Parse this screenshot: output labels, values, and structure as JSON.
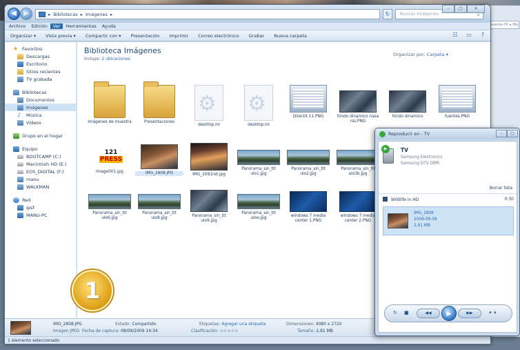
{
  "address": {
    "crumbs": [
      "Bibliotecas",
      "Imágenes"
    ],
    "search_placeholder": "Buscar Imágenes"
  },
  "menu": [
    "Archivo",
    "Edición",
    "Ver",
    "Herramientas",
    "Ayuda"
  ],
  "toolbar": [
    "Organizar ▾",
    "Vista previa ▾",
    "Compartir con ▾",
    "Presentación",
    "Imprimir",
    "Correo electrónico",
    "Grabar",
    "Nueva carpeta"
  ],
  "sidebar": {
    "favoritos": "Favoritos",
    "fav_items": [
      "Descargas",
      "Escritorio",
      "Sitios recientes",
      "TV grabada"
    ],
    "bibliotecas": "Bibliotecas",
    "lib_items": [
      "Documentos",
      "Imágenes",
      "Música",
      "Vídeos"
    ],
    "grupo": "Grupo en el hogar",
    "equipo": "Equipo",
    "equipo_items": [
      "BOOTCAMP (C:)",
      "Macintosh HD (E:)",
      "EOS_DIGITAL (F:)",
      "manu",
      "WALKMAN"
    ],
    "red": "Red",
    "red_items": [
      "ipsf",
      "MANU-PC"
    ]
  },
  "library": {
    "title": "Biblioteca Imágenes",
    "includes_label": "Incluye:",
    "includes_link": "2 ubicaciones",
    "arrange_label": "Organizar por:",
    "arrange_value": "Carpeta ▾"
  },
  "files": [
    {
      "name": "Imágenes de muestra"
    },
    {
      "name": "Presentaciones"
    },
    {
      "name": "desktop.ini"
    },
    {
      "name": "desktop.ini"
    },
    {
      "name": "DirectX 11.PNG"
    },
    {
      "name": "fondo dinamico nasa rss.PNG"
    },
    {
      "name": "fondo dinamico"
    },
    {
      "name": "fuentes.PNG"
    },
    {
      "name": "image001.jpg",
      "logo_text": "121",
      "logo_accent": "PRESS"
    },
    {
      "name": "IMG_2808.JPG"
    },
    {
      "name": "IMG_2091ret.jpg"
    },
    {
      "name": "Panorama_sin_tit ulo1.jpg"
    },
    {
      "name": "Panorama_sin_tit ulo2.jpg"
    },
    {
      "name": "Panorama_sin_tit ulo3b.jpg"
    },
    {
      "name": "Panorama_sin_tit ulo6.jpg"
    },
    {
      "name": "Panorama_sin_tit ulo8.jpg"
    },
    {
      "name": "Panorama_sin_tit ulo9.jpg"
    },
    {
      "name": "Panorama_sin_tit uloe.jpg"
    },
    {
      "name": "windows 7 media center 1.PNG"
    },
    {
      "name": "windows 7 media center 2.PNG"
    }
  ],
  "details": {
    "filename": "IMG_2808.JPG",
    "filetype": "Imagen JPEG",
    "estado_label": "Estado:",
    "estado_value": "Compartido",
    "etiquetas_label": "Etiquetas:",
    "etiquetas_value": "Agregar una etiqueta",
    "dim_label": "Dimensiones:",
    "dim_value": "4080 x 2720",
    "fecha_label": "Fecha de captura:",
    "fecha_value": "08/09/2009 14:34",
    "clasif_label": "Clasificación:",
    "clasif_value": "☆☆☆☆☆",
    "tam_label": "Tamaño:",
    "tam_value": "2,91 MB"
  },
  "status": "1 elemento seleccionado",
  "badge": "1",
  "playto": {
    "title": "Reproducir en - TV",
    "device_name": "TV",
    "device_maker": "Samsung Electronics",
    "device_model": "Samsung DTV DMR",
    "clear_list": "Borrar lista",
    "playlist_name": "Wildlife in HD",
    "playlist_duration": "0:30",
    "item_name": "IMG_2808",
    "item_date": "2009-09-08",
    "item_size": "2,91 MB"
  },
  "right_window": {
    "address": "Usuarios PC ▸ Ma"
  }
}
